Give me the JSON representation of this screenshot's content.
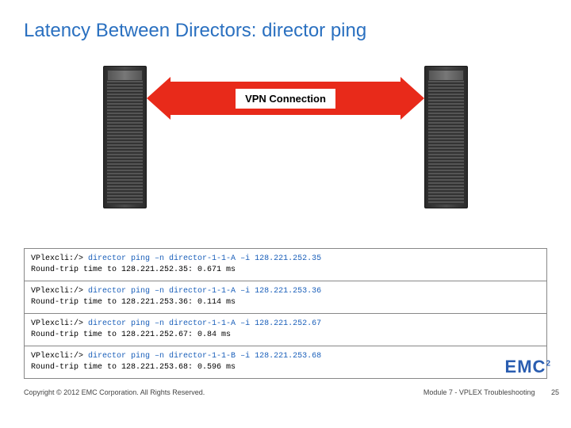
{
  "title": "Latency Between Directors:  director ping",
  "vpn_label": "VPN Connection",
  "cli": [
    {
      "prompt": "VPlexcli:/>",
      "cmd": "director ping –n director-1-1-A –i 128.221.252.35",
      "result": "Round-trip time to 128.221.252.35: 0.671 ms"
    },
    {
      "prompt": "VPlexcli:/>",
      "cmd": "director ping –n director-1-1-A –i 128.221.253.36",
      "result": "Round-trip time to 128.221.253.36: 0.114 ms"
    },
    {
      "prompt": "VPlexcli:/>",
      "cmd": "director ping –n director-1-1-A –i 128.221.252.67",
      "result": "Round-trip time to 128.221.252.67: 0.84 ms"
    },
    {
      "prompt": "VPlexcli:/>",
      "cmd": "director ping –n director-1-1-B –i 128.221.253.68",
      "result": "Round-trip time to 128.221.253.68: 0.596 ms"
    }
  ],
  "footer": {
    "copyright": "Copyright © 2012 EMC Corporation. All Rights Reserved.",
    "module": "Module 7 - VPLEX Troubleshooting",
    "page": "25",
    "logo_text": "EMC",
    "logo_sup": "2"
  }
}
